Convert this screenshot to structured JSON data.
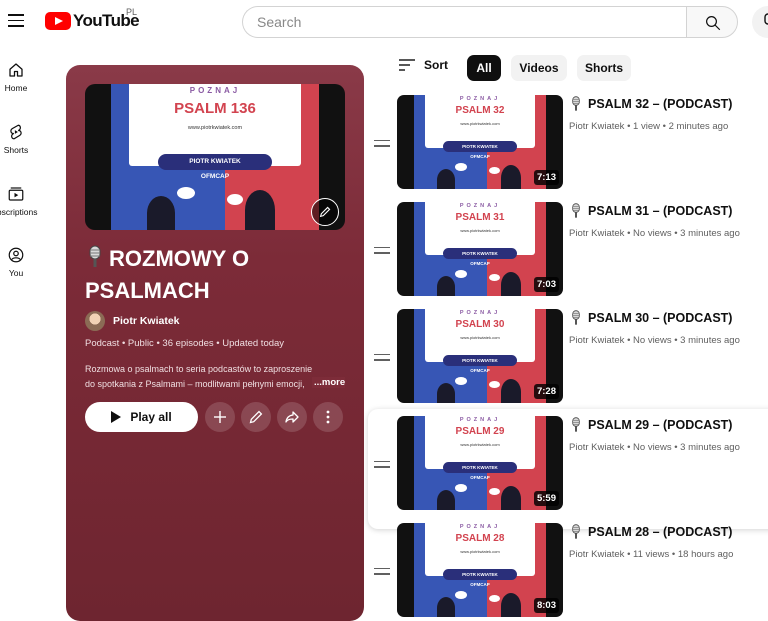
{
  "header": {
    "logo_text": "YouTube",
    "country_code": "PL",
    "search_placeholder": "Search"
  },
  "rail": [
    {
      "label": "Home",
      "icon": "home-icon"
    },
    {
      "label": "Shorts",
      "icon": "shorts-icon"
    },
    {
      "label": "Subscriptions",
      "icon": "subscriptions-icon"
    },
    {
      "label": "You",
      "icon": "you-icon"
    }
  ],
  "playlist": {
    "thumb": {
      "poznaj": "POZNAJ",
      "psalm": "PSALM 136",
      "url": "www.piotrkwiatek.com",
      "pill": "PIOTR KWIATEK",
      "ofm": "OFMCAP"
    },
    "title": "ROZMOWY O PSALMACH",
    "owner": "Piotr Kwiatek",
    "meta": "Podcast • Public • 36 episodes • Updated today",
    "desc_line1": "Rozmowa o psalmach  to seria podcastów to zaproszenie",
    "desc_line2": "do spotkania z Psalmami – modlitwami pełnymi emocji,",
    "more": "...more",
    "play_all": "Play all"
  },
  "filters": {
    "sort": "Sort",
    "chips": [
      "All",
      "Videos",
      "Shorts"
    ],
    "active": "All"
  },
  "videos": [
    {
      "title": "PSALM 32 – (PODCAST)",
      "meta": "Piotr Kwiatek • 1 view • 2 minutes ago",
      "duration": "7:13",
      "thumb_psalm": "PSALM 32"
    },
    {
      "title": "PSALM 31 – (PODCAST)",
      "meta": "Piotr Kwiatek • No views • 3 minutes ago",
      "duration": "7:03",
      "thumb_psalm": "PSALM 31"
    },
    {
      "title": "PSALM 30 – (PODCAST)",
      "meta": "Piotr Kwiatek • No views • 3 minutes ago",
      "duration": "7:28",
      "thumb_psalm": "PSALM 30"
    },
    {
      "title": "PSALM 29 – (PODCAST)",
      "meta": "Piotr Kwiatek • No views • 3 minutes ago",
      "duration": "5:59",
      "thumb_psalm": "PSALM 29"
    },
    {
      "title": "PSALM 28 – (PODCAST)",
      "meta": "Piotr Kwiatek • 11 views • 18 hours ago",
      "duration": "8:03",
      "thumb_psalm": "PSALM 28"
    }
  ],
  "colors": {
    "brand_red": "#ff0000",
    "panel_bg": "#7c2b38",
    "thumb_blue": "#3756b5",
    "thumb_red": "#d2434f"
  }
}
